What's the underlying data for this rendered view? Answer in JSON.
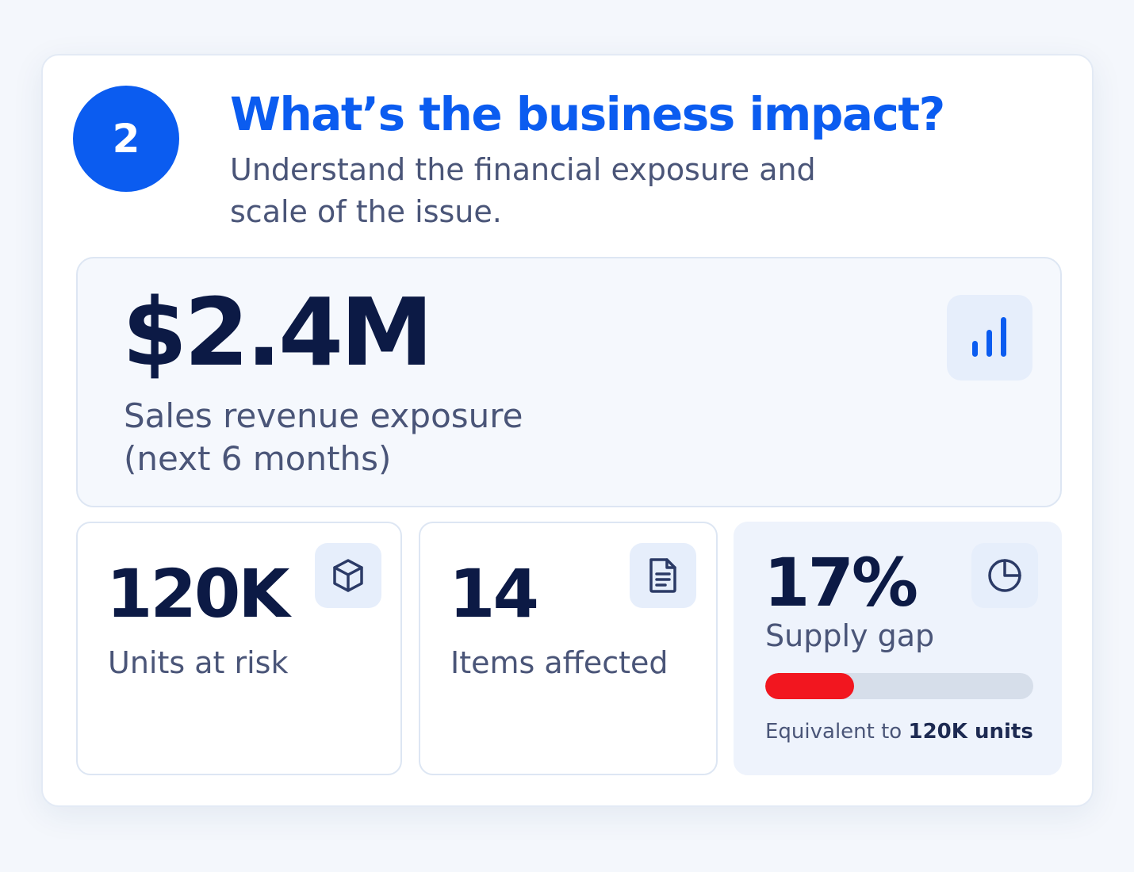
{
  "header": {
    "step_number": "2",
    "title": "What’s the business impact?",
    "subtitle": "Understand the financial exposure and scale of the issue."
  },
  "hero": {
    "value": "$2.4M",
    "label": "Sales revenue exposure (next 6 months)",
    "icon": "bar-chart-icon"
  },
  "stats": {
    "units": {
      "value": "120K",
      "label": "Units at risk",
      "icon": "box-icon"
    },
    "items": {
      "value": "14",
      "label": "Items affected",
      "icon": "document-icon"
    },
    "gap": {
      "value": "17%",
      "label": "Supply gap",
      "icon": "pie-chart-icon",
      "progress_fraction": 0.33,
      "footnote_prefix": "Equivalent to",
      "footnote_strong": "120K units"
    }
  },
  "colors": {
    "accent": "#0b5cf0",
    "heading": "#0c1a45",
    "muted": "#4a5578",
    "danger": "#f2161f"
  }
}
